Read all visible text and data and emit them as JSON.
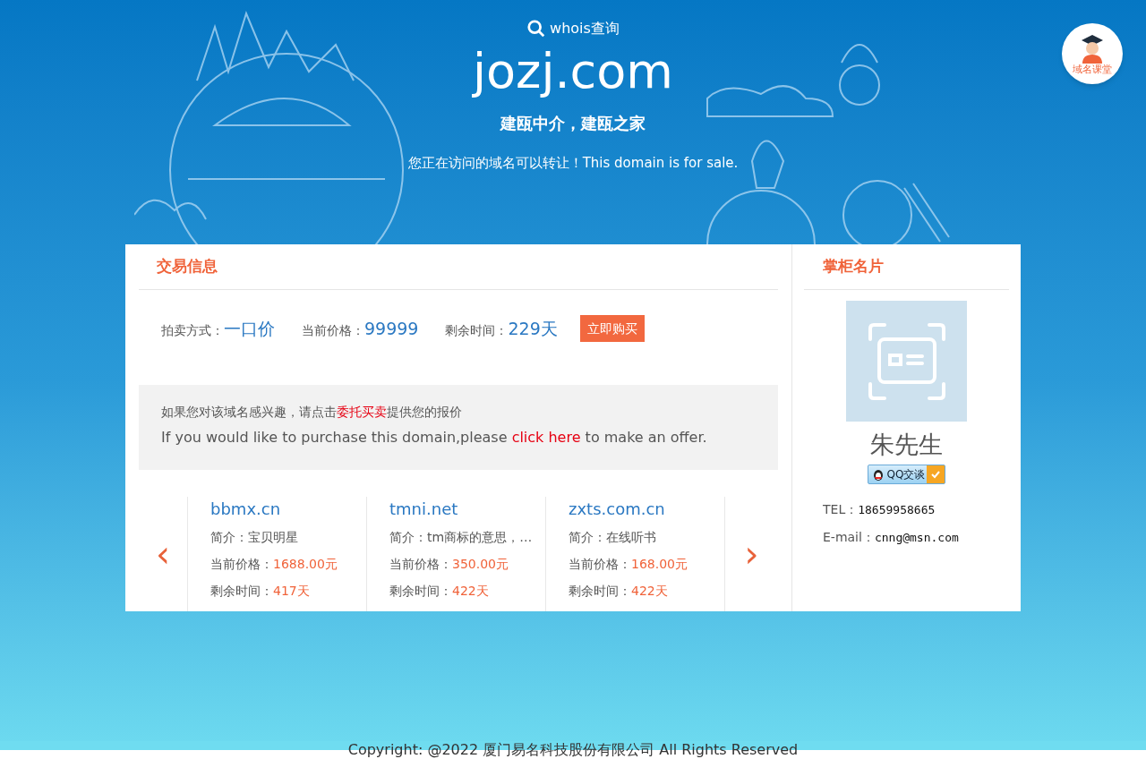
{
  "header": {
    "whois_link": "whois查询",
    "domain": "jozj.com",
    "slogan": "建瓯中介，建瓯之家",
    "notice": "您正在访问的域名可以转让！This domain is for sale."
  },
  "course_badge": {
    "label": "域名课堂"
  },
  "trade": {
    "title": "交易信息",
    "fields": [
      {
        "label": "拍卖方式：",
        "value": "一口价"
      },
      {
        "label": "当前价格：",
        "value": "99999"
      },
      {
        "label": "剩余时间：",
        "value": "229天"
      }
    ],
    "buy_button": "立即购买",
    "offer": {
      "cn_before": "如果您对该域名感兴趣，请点击",
      "cn_link": "委托买卖",
      "cn_after": "提供您的报价",
      "en_before": "If you would like to purchase this domain,please ",
      "en_link": "click here",
      "en_after": " to make an offer."
    },
    "prev": "‹",
    "next": "›",
    "related": [
      {
        "domain": "bbmx.cn",
        "intro_label": "简介：",
        "intro": "宝贝明星",
        "price_label": "当前价格：",
        "price": "1688.00元",
        "time_label": "剩余时间：",
        "time": "417天"
      },
      {
        "domain": "tmni.net",
        "intro_label": "简介：",
        "intro": "tm商标的意思，…",
        "price_label": "当前价格：",
        "price": "350.00元",
        "time_label": "剩余时间：",
        "time": "422天"
      },
      {
        "domain": "zxts.com.cn",
        "intro_label": "简介：",
        "intro": "在线听书",
        "price_label": "当前价格：",
        "price": "168.00元",
        "time_label": "剩余时间：",
        "time": "422天"
      }
    ]
  },
  "owner": {
    "title": "掌柜名片",
    "name": "朱先生",
    "qq_button": "QQ交谈",
    "tel_label": "TEL：",
    "tel": "18659958665",
    "email_label": "E-mail：",
    "email": "cnng@msn.com"
  },
  "footer": "Copyright: @2022 厦门易名科技股份有限公司 All Rights Reserved"
}
